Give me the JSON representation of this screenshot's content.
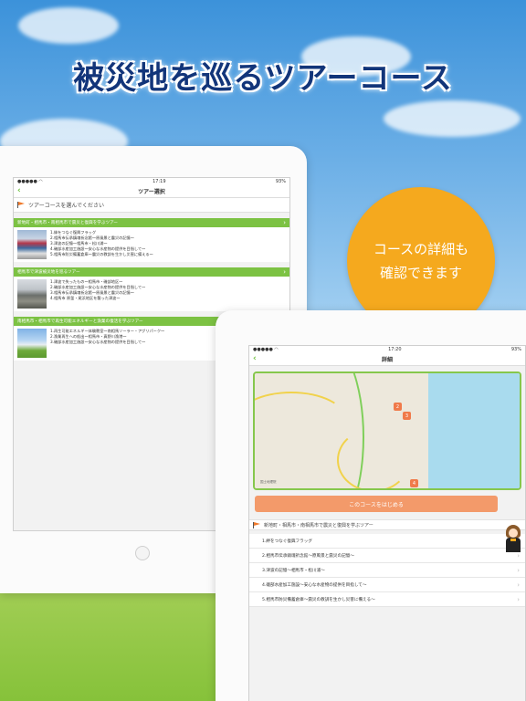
{
  "banner": {
    "headline": "被災地を巡るツアーコース",
    "badge_line1": "コースの詳細も",
    "badge_line2": "確認できます"
  },
  "screen1": {
    "status": {
      "time": "17:19",
      "battery": "93%"
    },
    "nav_title": "ツアー選択",
    "prompt": "ツアーコースを選んでください",
    "courses": [
      {
        "title": "新地町・相馬市・南相馬市で震災と復興を学ぶツアー",
        "items": [
          "1.絆をつなぐ復興フラッグ",
          "2.相馬市伝承鎮魂祈念館～原風景と震災の記憶～",
          "3.津波の記憶～相馬市・松川浦～",
          "4.磯部水産加工施設～安心な水産物の提供を目指して～",
          "5.相馬市防災備蓄倉庫～震災の教訓を生かし災害に備える～"
        ]
      },
      {
        "title": "相馬市で津波被災地を巡るツアー",
        "items": [
          "1.津波で失ったもの～相馬市・磯部地区～",
          "2.磯部水産加工施設～安心な水産物の提供を目指して～",
          "3.相馬市伝承鎮魂祈念館～原風景と震災の記憶～",
          "4.相馬市 原釜・尾浜地区を襲った津波～"
        ]
      },
      {
        "title": "南相馬市・相馬市で再生可能エネルギーと漁業の復活を学ぶツアー",
        "items": [
          "1.再生可能エネルギー体験教室～南相馬ソーラー・アグリパーク～",
          "2.漁業再生への船出～相馬市・真野川漁港～",
          "3.磯部水産加工施設～安心な水産物の提供を目指して～"
        ]
      }
    ]
  },
  "screen2": {
    "status": {
      "time": "17:20",
      "battery": "93%"
    },
    "nav_title": "詳細",
    "map_credit": "国土地理院",
    "map_pins": [
      "2",
      "3",
      "4"
    ],
    "start_button": "このコースをはじめる",
    "course_title": "新地町・相馬市・南相馬市で震災と復興を学ぶツアー",
    "spots": [
      "1.絆をつなぐ復興フラッグ",
      "2.相馬市伝承鎮魂祈念館～原風景と震災の記憶～",
      "3.津波の記憶～相馬市・松川浦～",
      "4.磯部水産加工施設～安心な水産物の提供を目指して～",
      "5.相馬市防災備蓄倉庫～震災の教訓を生かし災害に備える～"
    ]
  }
}
